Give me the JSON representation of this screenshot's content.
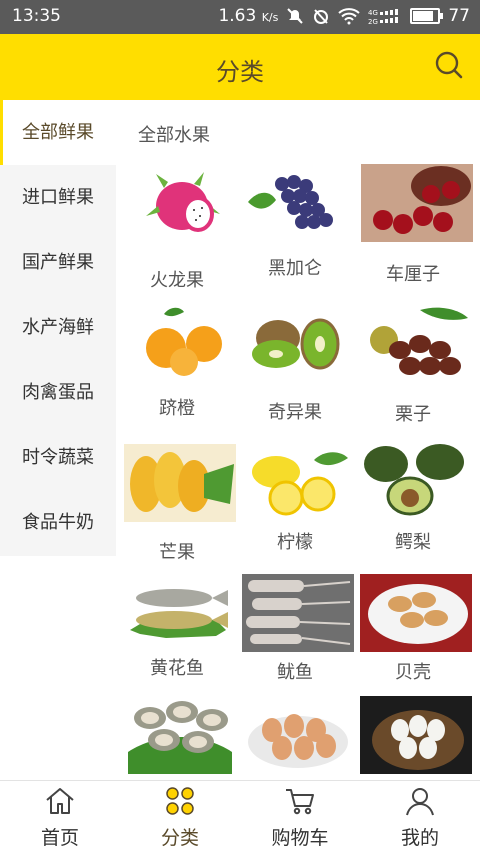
{
  "status": {
    "time": "13:35",
    "speed": "1.63",
    "speed_unit": "K/s",
    "battery": "77",
    "battery_level": 0.77
  },
  "header": {
    "title": "分类"
  },
  "sidebar": {
    "items": [
      {
        "label": "全部鲜果",
        "active": true
      },
      {
        "label": "进口鲜果"
      },
      {
        "label": "国产鲜果"
      },
      {
        "label": "水产海鲜"
      },
      {
        "label": "肉禽蛋品"
      },
      {
        "label": "时令蔬菜"
      },
      {
        "label": "食品牛奶"
      }
    ]
  },
  "content": {
    "subcategory": "全部水果",
    "products": [
      {
        "name": "火龙果",
        "icon": "dragon-fruit"
      },
      {
        "name": "黑加仑",
        "icon": "blackcurrant"
      },
      {
        "name": "车厘子",
        "icon": "cherry"
      },
      {
        "name": "跻橙",
        "icon": "orange"
      },
      {
        "name": "奇异果",
        "icon": "kiwi"
      },
      {
        "name": "栗子",
        "icon": "chestnut"
      },
      {
        "name": "芒果",
        "icon": "mango"
      },
      {
        "name": "柠檬",
        "icon": "lemon"
      },
      {
        "name": "鳄梨",
        "icon": "avocado"
      },
      {
        "name": "黄花鱼",
        "icon": "croaker-fish"
      },
      {
        "name": "鱿鱼",
        "icon": "squid"
      },
      {
        "name": "贝壳",
        "icon": "shellfish"
      },
      {
        "name": "",
        "icon": "oyster"
      },
      {
        "name": "",
        "icon": "egg"
      },
      {
        "name": "",
        "icon": "egg-basket"
      }
    ]
  },
  "tabbar": {
    "items": [
      {
        "label": "首页",
        "icon": "home-icon"
      },
      {
        "label": "分类",
        "icon": "category-icon",
        "active": true
      },
      {
        "label": "购物车",
        "icon": "cart-icon"
      },
      {
        "label": "我的",
        "icon": "user-icon"
      }
    ]
  },
  "colors": {
    "accent": "#ffde00",
    "statusbar": "#5a5a5a",
    "sidebar_bg": "#f5f5f5",
    "title_text": "#5a4a2a"
  }
}
